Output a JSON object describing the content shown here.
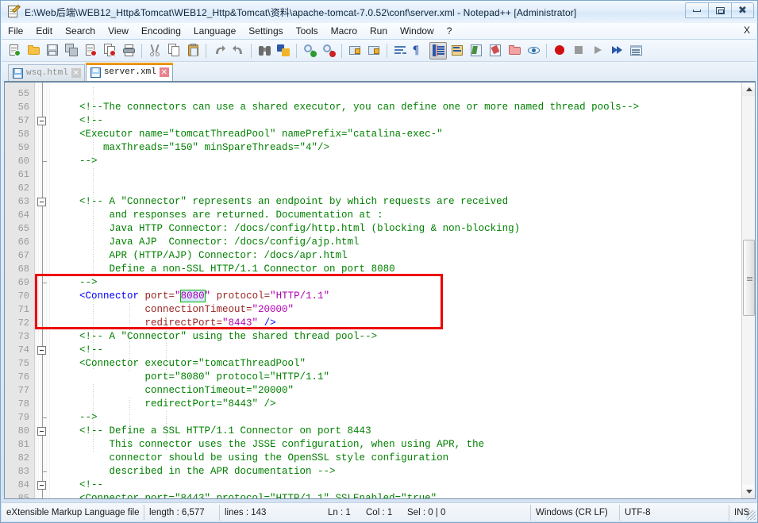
{
  "window": {
    "title": "E:\\Web后端\\WEB12_Http&Tomcat\\WEB12_Http&Tomcat\\资料\\apache-tomcat-7.0.52\\conf\\server.xml - Notepad++ [Administrator]",
    "app_icon": "notepad-plus-plus-icon",
    "controls": {
      "minimize": "minimize-icon",
      "maximize": "maximize-icon",
      "close": "close-icon"
    }
  },
  "menu": {
    "items": [
      {
        "label": "File"
      },
      {
        "label": "Edit"
      },
      {
        "label": "Search"
      },
      {
        "label": "View"
      },
      {
        "label": "Encoding"
      },
      {
        "label": "Language"
      },
      {
        "label": "Settings"
      },
      {
        "label": "Tools"
      },
      {
        "label": "Macro"
      },
      {
        "label": "Run"
      },
      {
        "label": "Window"
      },
      {
        "label": "?"
      }
    ],
    "close_document": "X"
  },
  "toolbar": {
    "buttons": [
      "new-file-icon",
      "open-file-icon",
      "save-icon",
      "save-all-icon",
      "close-file-icon",
      "close-all-icon",
      "print-icon",
      "sep",
      "cut-icon",
      "copy-icon",
      "paste-icon",
      "sep",
      "undo-icon",
      "redo-icon",
      "sep",
      "find-icon",
      "replace-icon",
      "sep",
      "zoom-in-icon",
      "zoom-out-icon",
      "sep",
      "sync-vertical-scroll-icon",
      "sync-horizontal-scroll-icon",
      "sep",
      "word-wrap-icon",
      "show-all-characters-icon",
      "show-indent-guide-icon",
      "ui-user-defined-dialog-icon",
      "show-document-map-icon",
      "function-list-icon",
      "folder-as-workspace-icon",
      "monitoring-icon",
      "sep",
      "record-macro-icon",
      "stop-recording-icon",
      "play-macro-icon",
      "run-macro-multiple-icon",
      "run-dialog-icon"
    ]
  },
  "tabs": [
    {
      "label": "wsq.html",
      "active": false,
      "icon": "saved-file-icon",
      "close": "tab-close-icon"
    },
    {
      "label": "server.xml",
      "active": true,
      "icon": "saved-file-icon",
      "close": "tab-close-icon"
    }
  ],
  "editor": {
    "first_line": 55,
    "lines": [
      {
        "n": 55,
        "fold": "none",
        "tokens": []
      },
      {
        "n": 56,
        "fold": "none",
        "tokens": [
          {
            "t": "cm",
            "s": "    <!--The connectors can use a shared executor, you can define one or more named thread pools-->"
          }
        ]
      },
      {
        "n": 57,
        "fold": "open",
        "tokens": [
          {
            "t": "cm",
            "s": "    <!--"
          }
        ]
      },
      {
        "n": 58,
        "fold": "none",
        "tokens": [
          {
            "t": "cm",
            "s": "    <Executor name=\"tomcatThreadPool\" namePrefix=\"catalina-exec-\""
          }
        ]
      },
      {
        "n": 59,
        "fold": "none",
        "tokens": [
          {
            "t": "cm",
            "s": "        maxThreads=\"150\" minSpareThreads=\"4\"/>"
          }
        ]
      },
      {
        "n": 60,
        "fold": "end",
        "tokens": [
          {
            "t": "cm",
            "s": "    -->"
          }
        ]
      },
      {
        "n": 61,
        "fold": "none",
        "tokens": []
      },
      {
        "n": 62,
        "fold": "none",
        "tokens": []
      },
      {
        "n": 63,
        "fold": "open",
        "tokens": [
          {
            "t": "cm",
            "s": "    <!-- A \"Connector\" represents an endpoint by which requests are received"
          }
        ]
      },
      {
        "n": 64,
        "fold": "none",
        "tokens": [
          {
            "t": "cm",
            "s": "         and responses are returned. Documentation at :"
          }
        ]
      },
      {
        "n": 65,
        "fold": "none",
        "tokens": [
          {
            "t": "cm",
            "s": "         Java HTTP Connector: /docs/config/http.html (blocking & non-blocking)"
          }
        ]
      },
      {
        "n": 66,
        "fold": "none",
        "tokens": [
          {
            "t": "cm",
            "s": "         Java AJP  Connector: /docs/config/ajp.html"
          }
        ]
      },
      {
        "n": 67,
        "fold": "none",
        "tokens": [
          {
            "t": "cm",
            "s": "         APR (HTTP/AJP) Connector: /docs/apr.html"
          }
        ]
      },
      {
        "n": 68,
        "fold": "none",
        "tokens": [
          {
            "t": "cm",
            "s": "         Define a non-SSL HTTP/1.1 Connector on port 8080"
          }
        ]
      },
      {
        "n": 69,
        "fold": "end",
        "tokens": [
          {
            "t": "cm",
            "s": "    -->"
          }
        ]
      },
      {
        "n": 70,
        "fold": "none",
        "tokens": [
          {
            "t": "tg",
            "s": "    <Connector "
          },
          {
            "t": "at",
            "s": "port="
          },
          {
            "t": "vl",
            "s": "\""
          },
          {
            "t": "hl",
            "s": "8080"
          },
          {
            "t": "vl",
            "s": "\""
          },
          {
            "t": "at",
            "s": " protocol="
          },
          {
            "t": "vl",
            "s": "\"HTTP/1.1\""
          }
        ]
      },
      {
        "n": 71,
        "fold": "none",
        "tokens": [
          {
            "t": "at",
            "s": "               connectionTimeout="
          },
          {
            "t": "vl",
            "s": "\"20000\""
          }
        ]
      },
      {
        "n": 72,
        "fold": "none",
        "tokens": [
          {
            "t": "at",
            "s": "               redirectPort="
          },
          {
            "t": "vl",
            "s": "\"8443\" "
          },
          {
            "t": "pn",
            "s": "/>"
          }
        ]
      },
      {
        "n": 73,
        "fold": "none",
        "tokens": [
          {
            "t": "cm",
            "s": "    <!-- A \"Connector\" using the shared thread pool-->"
          }
        ]
      },
      {
        "n": 74,
        "fold": "open",
        "tokens": [
          {
            "t": "cm",
            "s": "    <!--"
          }
        ]
      },
      {
        "n": 75,
        "fold": "none",
        "tokens": [
          {
            "t": "cm",
            "s": "    <Connector executor=\"tomcatThreadPool\""
          }
        ]
      },
      {
        "n": 76,
        "fold": "none",
        "tokens": [
          {
            "t": "cm",
            "s": "               port=\"8080\" protocol=\"HTTP/1.1\""
          }
        ]
      },
      {
        "n": 77,
        "fold": "none",
        "tokens": [
          {
            "t": "cm",
            "s": "               connectionTimeout=\"20000\""
          }
        ]
      },
      {
        "n": 78,
        "fold": "none",
        "tokens": [
          {
            "t": "cm",
            "s": "               redirectPort=\"8443\" />"
          }
        ]
      },
      {
        "n": 79,
        "fold": "end",
        "tokens": [
          {
            "t": "cm",
            "s": "    -->"
          }
        ]
      },
      {
        "n": 80,
        "fold": "open",
        "tokens": [
          {
            "t": "cm",
            "s": "    <!-- Define a SSL HTTP/1.1 Connector on port 8443"
          }
        ]
      },
      {
        "n": 81,
        "fold": "none",
        "tokens": [
          {
            "t": "cm",
            "s": "         This connector uses the JSSE configuration, when using APR, the"
          }
        ]
      },
      {
        "n": 82,
        "fold": "none",
        "tokens": [
          {
            "t": "cm",
            "s": "         connector should be using the OpenSSL style configuration"
          }
        ]
      },
      {
        "n": 83,
        "fold": "end",
        "tokens": [
          {
            "t": "cm",
            "s": "         described in the APR documentation -->"
          }
        ]
      },
      {
        "n": 84,
        "fold": "open",
        "tokens": [
          {
            "t": "cm",
            "s": "    <!--"
          }
        ]
      },
      {
        "n": 85,
        "fold": "none",
        "tokens": [
          {
            "t": "cm",
            "s": "    <Connector port=\"8443\" protocol=\"HTTP/1.1\" SSLEnabled=\"true\""
          }
        ]
      }
    ],
    "highlight_box": {
      "label": "connector-port-annotation",
      "color": "#ee0000"
    },
    "selected_text": "8080"
  },
  "statusbar": {
    "file_type": "eXtensible Markup Language file",
    "length": "length : 6,577",
    "lines": "lines : 143",
    "ln": "Ln : 1",
    "col": "Col : 1",
    "sel": "Sel : 0 | 0",
    "eol": "Windows (CR LF)",
    "encoding": "UTF-8",
    "insert_mode": "INS"
  },
  "colors": {
    "comment": "#008000",
    "tag": "#0000ff",
    "attribute": "#9b2323",
    "value": "#b000b0",
    "annotation": "#ee0000",
    "tab_active_accent": "#f5a623"
  }
}
